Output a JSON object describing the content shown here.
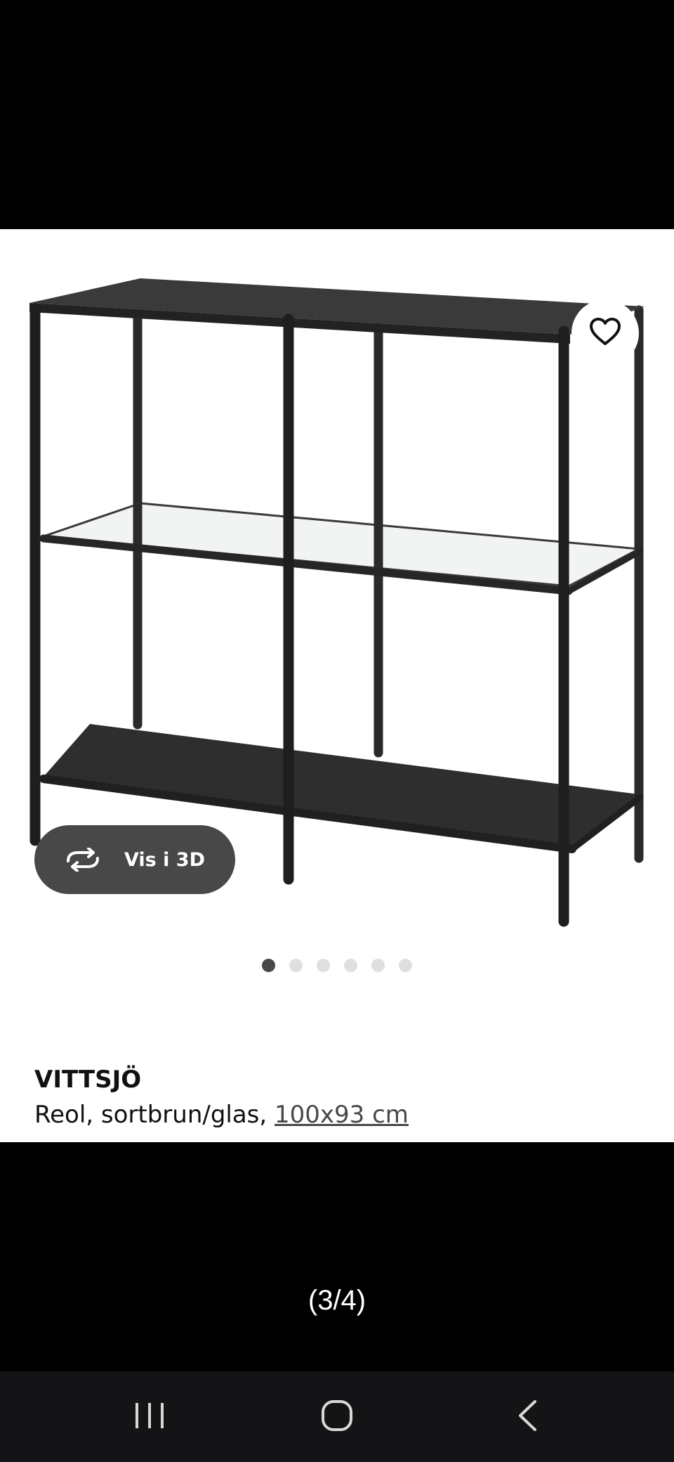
{
  "product": {
    "brand": "VITTSJÖ",
    "description": "Reol, sortbrun/glas, ",
    "measurement": "100x93 cm"
  },
  "image_viewer": {
    "view_3d_label": "Vis i 3D",
    "dot_count": 6,
    "active_dot": 1,
    "counter": "(3/4)"
  },
  "icons": {
    "favorite": "heart-icon",
    "rotate": "rotate-3d-icon",
    "recent_apps": "recent-apps-icon",
    "home": "home-icon",
    "back": "back-icon"
  },
  "colors": {
    "background": "#000000",
    "card": "#ffffff",
    "button_dark": "#484848",
    "dot_inactive": "#dfdfdf",
    "navbar": "#141416"
  }
}
